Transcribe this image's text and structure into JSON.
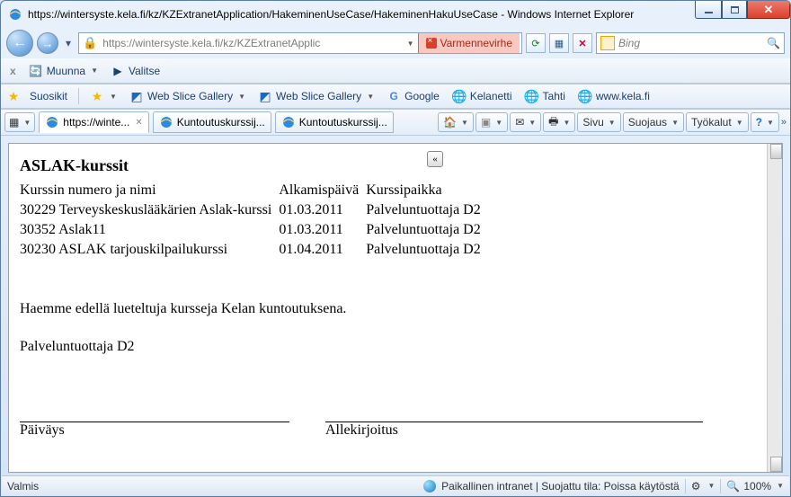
{
  "window": {
    "title": "https://wintersyste.kela.fi/kz/KZExtranetApplication/HakeminenUseCase/HakeminenHakuUseCase - Windows Internet Explorer"
  },
  "nav": {
    "url_display": "https://wintersyste.kela.fi/kz/KZExtranetApplic",
    "cert_error": "Varmennevirhe",
    "search_placeholder": "Bing"
  },
  "translate_bar": {
    "convert": "Muunna",
    "select": "Valitse"
  },
  "favorites_bar": {
    "favorites": "Suosikit",
    "links": [
      "Web Slice Gallery",
      "Web Slice Gallery",
      "Google",
      "Kelanetti",
      "Tahti",
      "www.kela.fi"
    ]
  },
  "tabs": [
    {
      "label": "https://winte...",
      "active": true
    },
    {
      "label": "Kuntoutuskurssij...",
      "active": false
    },
    {
      "label": "Kuntoutuskurssij...",
      "active": false
    }
  ],
  "command_bar": {
    "page": "Sivu",
    "safety": "Suojaus",
    "tools": "Työkalut"
  },
  "document": {
    "heading": "ASLAK-kurssit",
    "collapse_glyph": "«",
    "columns": {
      "c1": "Kurssin numero ja nimi",
      "c2": "Alkamispäivä",
      "c3": "Kurssipaikka"
    },
    "rows": [
      {
        "c1": "30229 Terveyskeskuslääkärien Aslak-kurssi",
        "c2": "01.03.2011",
        "c3": "Palveluntuottaja D2"
      },
      {
        "c1": "30352 Aslak11",
        "c2": "01.03.2011",
        "c3": "Palveluntuottaja D2"
      },
      {
        "c1": "30230 ASLAK tarjouskilpailukurssi",
        "c2": "01.04.2011",
        "c3": "Palveluntuottaja D2"
      }
    ],
    "sentence": "Haemme edellä lueteltuja kursseja Kelan kuntoutuksena.",
    "provider": "Palveluntuottaja D2",
    "sig_date": "Päiväys",
    "sig_sign": "Allekirjoitus"
  },
  "status": {
    "ready": "Valmis",
    "zone": "Paikallinen intranet | Suojattu tila: Poissa käytöstä",
    "zoom": "100%"
  }
}
